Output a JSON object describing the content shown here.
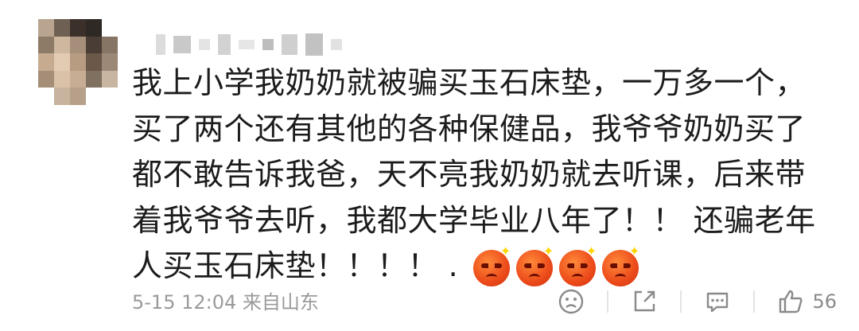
{
  "comment": {
    "avatar_icon": "blurred-avatar",
    "text": "我上小学我奶奶就被骗买玉石床垫，一万多一个，买了两个还有其他的各种保健品，我爷爷奶奶买了都不敢告诉我爸，天不亮我奶奶就去听课，后来带着我爷爷去听，我都大学毕业八年了！！ 还骗老年人买玉石床垫！！！！ .",
    "emoji_icons": [
      "angry-face-icon",
      "angry-face-icon",
      "angry-face-icon",
      "angry-face-icon"
    ],
    "timestamp": "5-15 12:04",
    "location": "来自山东"
  },
  "actions": {
    "dislike_icon": "frown-face-icon",
    "share_icon": "share-icon",
    "reply_icon": "comment-icon",
    "like_icon": "thumbs-up-icon",
    "like_count": "56"
  },
  "colors": {
    "text": "#1c1c1c",
    "meta": "#9a9a9a",
    "icon": "#8a8a8a",
    "emoji": "#ec4a1a"
  }
}
